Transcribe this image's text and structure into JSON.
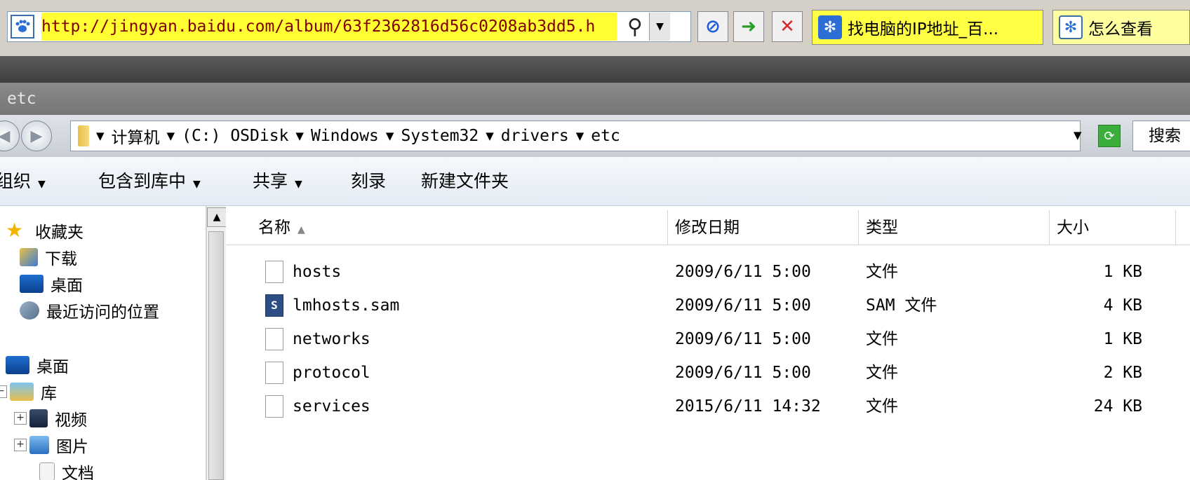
{
  "browser": {
    "url": "http://jingyan.baidu.com/album/63f2362816d56c0208ab3dd5.h",
    "tabs": [
      {
        "label": "找电脑的IP地址_百..."
      },
      {
        "label": "怎么查看"
      }
    ],
    "colors": {
      "url_highlight": "#ffff33",
      "url_text": "#800000"
    }
  },
  "window": {
    "title": "etc"
  },
  "breadcrumb": {
    "items": [
      "计算机",
      "(C:) OSDisk",
      "Windows",
      "System32",
      "drivers",
      "etc"
    ],
    "search_placeholder": "搜索"
  },
  "command_bar": {
    "organize": "组织",
    "include_in_library": "包含到库中",
    "share": "共享",
    "burn": "刻录",
    "new_folder": "新建文件夹"
  },
  "nav_pane": {
    "favorites": "收藏夹",
    "downloads": "下载",
    "desktop_fav": "桌面",
    "recent_places": "最近访问的位置",
    "desktop": "桌面",
    "libraries": "库",
    "videos": "视频",
    "pictures": "图片",
    "documents": "文档"
  },
  "file_list": {
    "columns": {
      "name": "名称",
      "date": "修改日期",
      "type": "类型",
      "size": "大小"
    },
    "rows": [
      {
        "name": "hosts",
        "date": "2009/6/11 5:00",
        "type": "文件",
        "size": "1 KB",
        "icon": "blank-file-icon"
      },
      {
        "name": "lmhosts.sam",
        "date": "2009/6/11 5:00",
        "type": "SAM 文件",
        "size": "4 KB",
        "icon": "sam-file-icon"
      },
      {
        "name": "networks",
        "date": "2009/6/11 5:00",
        "type": "文件",
        "size": "1 KB",
        "icon": "blank-file-icon"
      },
      {
        "name": "protocol",
        "date": "2009/6/11 5:00",
        "type": "文件",
        "size": "2 KB",
        "icon": "blank-file-icon"
      },
      {
        "name": "services",
        "date": "2015/6/11 14:32",
        "type": "文件",
        "size": "24 KB",
        "icon": "blank-file-icon"
      }
    ]
  }
}
